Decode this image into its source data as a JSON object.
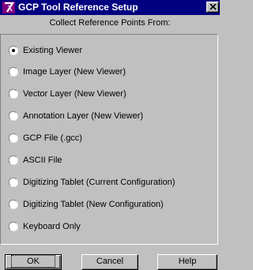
{
  "window": {
    "title": "GCP Tool Reference Setup"
  },
  "header": {
    "subtitle": "Collect Reference Points From:"
  },
  "options": [
    {
      "label": "Existing Viewer",
      "selected": true
    },
    {
      "label": "Image Layer (New Viewer)",
      "selected": false
    },
    {
      "label": "Vector Layer (New Viewer)",
      "selected": false
    },
    {
      "label": "Annotation Layer (New Viewer)",
      "selected": false
    },
    {
      "label": "GCP File (.gcc)",
      "selected": false
    },
    {
      "label": "ASCII File",
      "selected": false
    },
    {
      "label": "Digitizing Tablet (Current Configuration)",
      "selected": false
    },
    {
      "label": "Digitizing Tablet (New Configuration)",
      "selected": false
    },
    {
      "label": "Keyboard Only",
      "selected": false
    }
  ],
  "buttons": {
    "ok": "OK",
    "cancel": "Cancel",
    "help": "Help"
  },
  "colors": {
    "titlebar": "#000080",
    "face": "#c0c0c0",
    "app_icon": "#800080"
  },
  "icons": {
    "app": "app-logo-icon",
    "close": "close-icon",
    "radio": "radio-icon"
  }
}
